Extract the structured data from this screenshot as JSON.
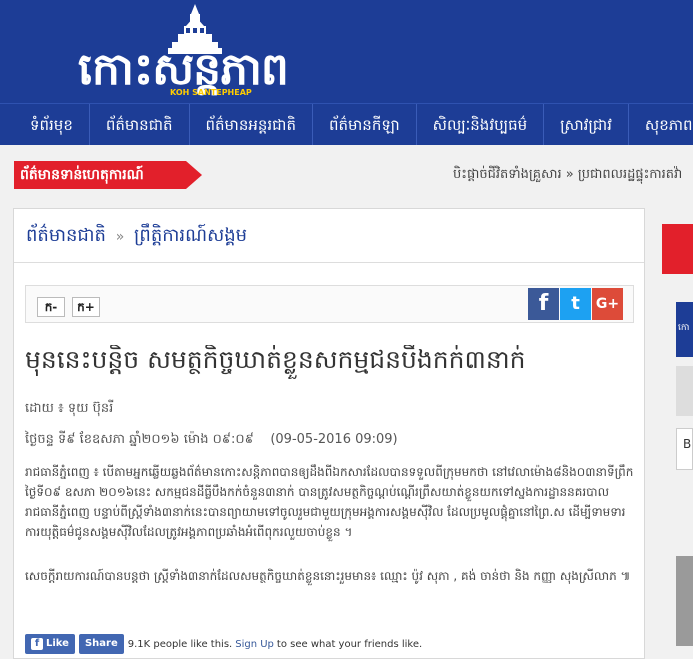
{
  "header": {
    "logo_text": "កោះសន្តិភាព",
    "logo_sub": "KOH SANTEPHEAP"
  },
  "nav": {
    "items": [
      {
        "label": "ទំព័រមុខ"
      },
      {
        "label": "ព័ត៌មានជាតិ"
      },
      {
        "label": "ព័ត៌មានអន្តរជាតិ"
      },
      {
        "label": "ព័ត៌មានកីឡា"
      },
      {
        "label": "សិល្បៈនិងវប្បធម៌"
      },
      {
        "label": "ស្រាវជ្រាវ"
      },
      {
        "label": "សុខភាព"
      }
    ]
  },
  "breaking": {
    "label": "ព័ត៌មានទាន់ហេតុការណ៍",
    "ticker": "បិះផ្តាច់ជីវិតទាំងគ្រួសារ  »  ប្រជាពលរដ្ឋផ្ទុះការតវ៉ា"
  },
  "breadcrumb": {
    "section": "ព័ត៌មានជាតិ",
    "separator": "»",
    "subsection": "ព្រឹត្តិការណ៍សង្គម"
  },
  "toolbar": {
    "font_decrease": "ក-",
    "font_increase": "ក+",
    "share_facebook": "f",
    "share_twitter": "t",
    "share_google": "G+"
  },
  "article": {
    "title": "មុននេះបន្តិច សមត្ថកិច្ចឃាត់ខ្លួនសកម្មជនបឹងកក់៣នាក់",
    "byline": "ដោយ ៖ ទុយ ប៊ុនរី",
    "date_kh": "ថ្ងៃចន្ទ ទី៩ ខែឧសភា ឆ្នាំ២០១៦ ម៉ោង ០៩:០៩",
    "date_num": "(09-05-2016 09:09)",
    "paragraph1": "រាជធានីភ្នំពេញ ៖ បើតាមអ្នកឆ្លើយឆ្លងព័ត៌មានកោះសន្តិភាពបានឲ្យដឹងពីឯកសារដែលបានទទួលពីក្រុមមកថា នៅវេលាម៉ោង៨និង០៣នាទីព្រឹកថ្ងៃទី០៩ ឧសភា ២០១៦នេះ សកម្មជនដីធ្លីបឹងកក់ចំនួន៣នាក់ បានត្រូវសមត្ថកិច្ចណ្តប់ណ្តើរព្រឹសយាត់ខ្លួនយកទៅស្នងការដ្ឋាននគរបាលរាជធានីភ្នំពេញ បន្ទាប់ពីស្ត្រីទាំង៣នាក់នេះបានព្យាយាមទៅចូលរួមជាមួយក្រុមអង្គការសង្គមស៊ីវិល ដែលប្រមូលផ្តុំគ្នានៅព្រៃ.ស ដើម្បីទាមទារការយុត្តិធម៌ជូនសង្គមស៊ីវិលដែលត្រូវអង្គភាពប្រឆាំងអំពើពុករលួយចាប់ខ្លួន ។",
    "paragraph2": "សេចក្តីរាយការណ៍បានបន្តថា ស្ត្រីទាំង៣នាក់ដែលសមត្ថកិច្ចឃាត់ខ្លួននោះរួមមាន៖ ឈ្មោះ ប៉ូវ សុភា , គង់ ចាន់ថា និង កញ្ញា សុងស្រីលាភ ៕"
  },
  "fb_widget": {
    "like_label": "Like",
    "share_label": "Share",
    "count_text": "9.1K people like this.",
    "signup_label": "Sign Up",
    "suffix_text": "to see what your friends like."
  },
  "sidebar": {
    "letter": "B",
    "blue_text": "កោ"
  },
  "colors": {
    "brand_blue": "#1d3d96",
    "breaking_red": "#e2202b",
    "facebook": "#3b5998",
    "twitter": "#1da1f2",
    "google": "#dd4b39"
  }
}
